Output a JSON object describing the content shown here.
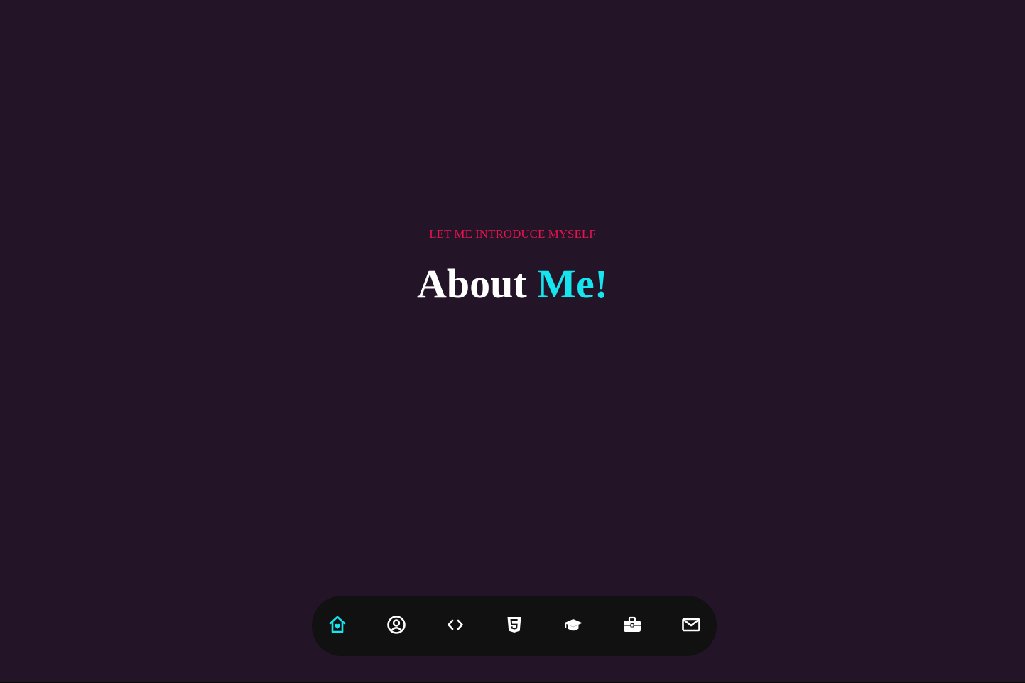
{
  "hero": {
    "eyebrow": "LET ME INTRODUCE MYSELF",
    "title_main": "About ",
    "title_accent": "Me!"
  },
  "nav": {
    "items": [
      {
        "icon": "home-heart-icon",
        "active": true
      },
      {
        "icon": "user-circle-icon",
        "active": false
      },
      {
        "icon": "code-icon",
        "active": false
      },
      {
        "icon": "html5-icon",
        "active": false
      },
      {
        "icon": "graduation-cap-icon",
        "active": false
      },
      {
        "icon": "briefcase-icon",
        "active": false
      },
      {
        "icon": "mail-icon",
        "active": false
      }
    ]
  },
  "colors": {
    "background": "#241428",
    "dock": "#111111",
    "accent": "#16e4ee",
    "eyebrow": "#e8134f",
    "icon": "#ffffff"
  }
}
